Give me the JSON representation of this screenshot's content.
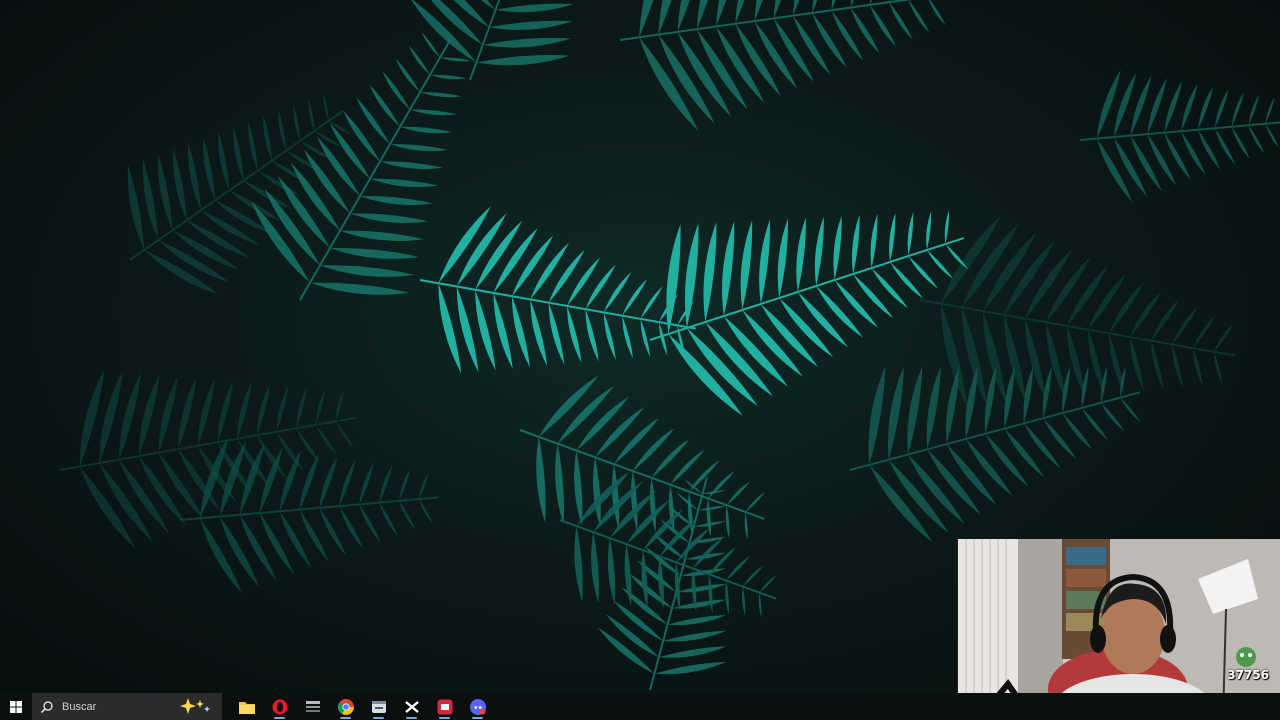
{
  "desktop": {
    "wallpaper": "dark-fern-leaves",
    "accent_color": "#1fa89a"
  },
  "taskbar": {
    "background": "#0c0f10",
    "search": {
      "placeholder": "Buscar",
      "icon": "search-icon"
    },
    "pinned": [
      {
        "name": "file-explorer-icon",
        "active": false
      },
      {
        "name": "opera-gx-icon",
        "active": true
      },
      {
        "name": "lucky-patcher-icon",
        "active": false
      },
      {
        "name": "chrome-icon",
        "active": true
      },
      {
        "name": "app-window-icon",
        "active": true
      },
      {
        "name": "capcut-icon",
        "active": true
      },
      {
        "name": "red-app-icon",
        "active": true
      },
      {
        "name": "discord-icon",
        "active": true
      }
    ]
  },
  "webcam_overlay": {
    "viewer_count": "37756"
  }
}
